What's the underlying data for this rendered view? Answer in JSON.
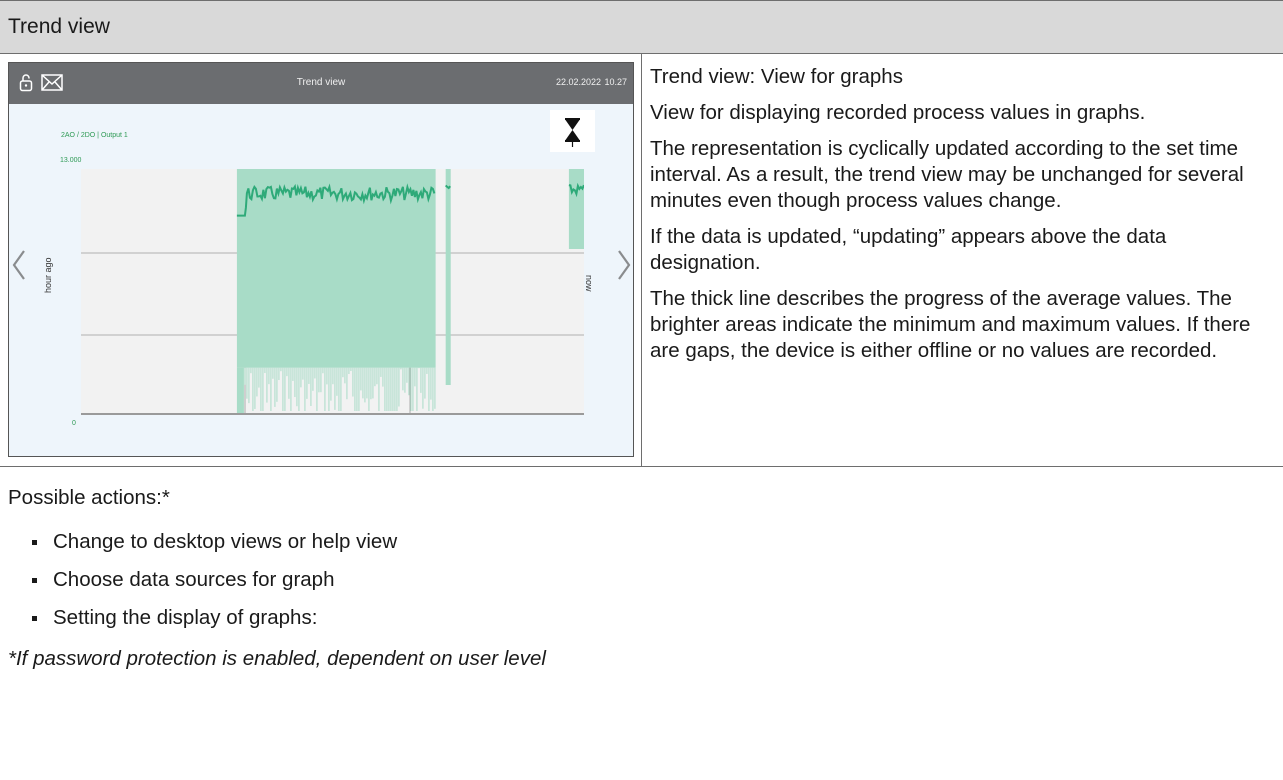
{
  "page": {
    "title": "Trend view"
  },
  "device": {
    "title": "Trend view",
    "date": "22.02.2022",
    "time": "10.27",
    "series_label": "2AO / 2DO | Output 1",
    "y_max_label": "13.000",
    "y_min_label": "0",
    "left_axis_label": "hour ago",
    "right_axis_label": "now",
    "icons": [
      "lock-icon",
      "mail-icon",
      "pause-hourglass-icon",
      "chevron-left-icon",
      "chevron-right-icon"
    ],
    "colors": {
      "header": "#6b6d70",
      "background": "#eef5fb",
      "average_line": "#2eaa79",
      "min_max_band": "#a8dcc7"
    }
  },
  "chart_data": {
    "type": "area",
    "ylim": [
      0,
      13000
    ],
    "title": "2AO / 2DO | Output 1",
    "xlabel": "",
    "ylabel": "",
    "segments": [
      {
        "x_start": 0.31,
        "x_end": 0.705,
        "avg_approx": 11700,
        "band_max": 13000,
        "band_min_approx": 2500
      },
      {
        "x_start": 0.725,
        "x_end": 0.735,
        "avg_approx": 12000
      },
      {
        "x_start": 0.97,
        "x_end": 1.0,
        "avg_approx": 11900
      }
    ]
  },
  "description": {
    "heading": "Trend view: View for graphs",
    "paragraphs": [
      "View for displaying recorded process values in graphs.",
      "The representation is cyclically updated according to the set time interval. As a result, the trend view may be unchanged for several minutes even though process values change.",
      "If the data is updated, “updating” appears above the data designation.",
      "The thick line describes the progress of the average values. The brighter areas indicate the minimum and maximum values. If there are gaps, the device is either offline or no values are recorded."
    ]
  },
  "actions": {
    "title": "Possible actions:*",
    "items": [
      "Change to desktop views or help view",
      "Choose data sources for graph",
      "Setting the display of graphs:"
    ],
    "footnote": "*If password protection is enabled, dependent on user level"
  }
}
